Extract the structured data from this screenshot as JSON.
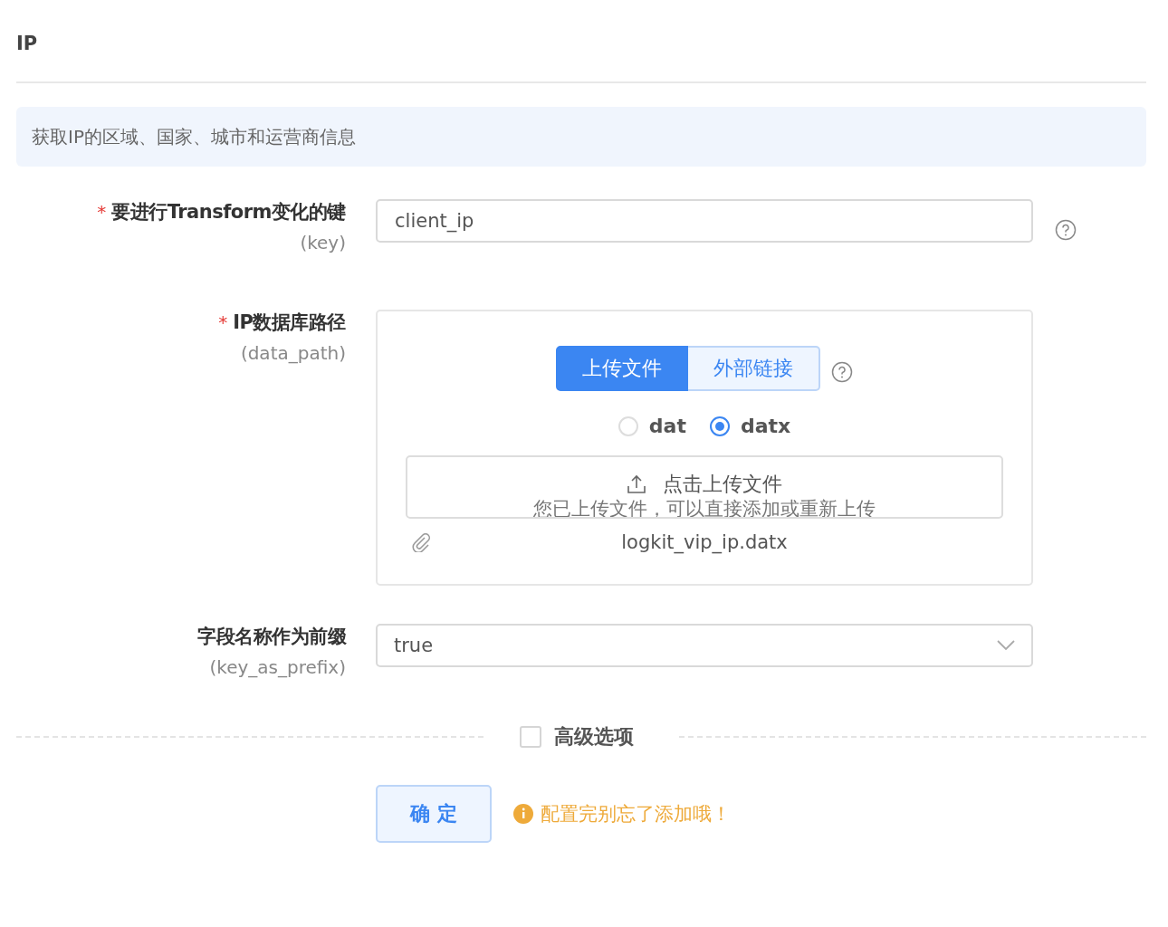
{
  "title": "IP",
  "description": "获取IP的区域、国家、城市和运营商信息",
  "fields": [
    {
      "kind": "text",
      "required_mark": "*",
      "label": "要进行Transform变化的键",
      "key": "(key)",
      "value": "client_ip",
      "help": true
    },
    {
      "kind": "upload",
      "required_mark": "*",
      "label": "IP数据库路径",
      "key": "(data_path)",
      "help": true,
      "source_tabs": [
        {
          "label": "上传文件",
          "selected": true
        },
        {
          "label": "外部链接",
          "selected": false
        }
      ],
      "formats": [
        {
          "label": "dat",
          "selected": false
        },
        {
          "label": "datx",
          "selected": true
        }
      ],
      "upload_button": {
        "title": "点击上传文件",
        "hint": "您已上传文件，可以直接添加或重新上传"
      },
      "file": "logkit_vip_ip.datx"
    },
    {
      "kind": "select",
      "label": "字段名称作为前缀",
      "key": "(key_as_prefix)",
      "value": "true",
      "help": false
    }
  ],
  "advanced": {
    "label": "高级选项",
    "checked": false
  },
  "submit": "确 定",
  "notice": "配置完别忘了添加哦！"
}
